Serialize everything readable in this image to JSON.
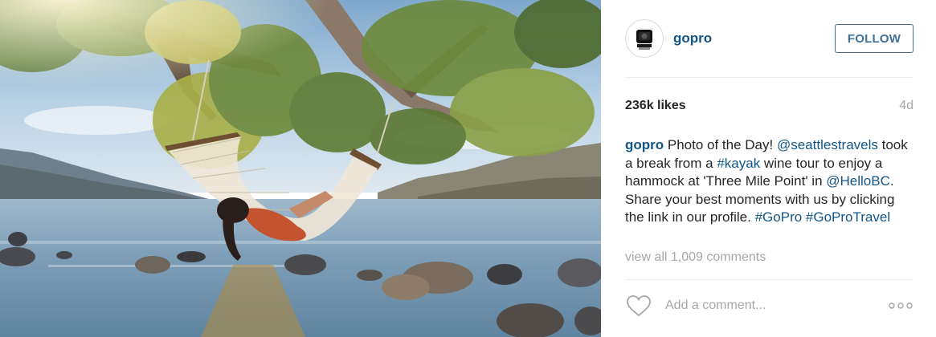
{
  "photo": {
    "alt": "Woman relaxing in a hammock hanging from a tree over a lake"
  },
  "header": {
    "username": "gopro",
    "follow_label": "FOLLOW"
  },
  "meta": {
    "likes": "236k likes",
    "timestamp": "4d"
  },
  "caption": {
    "author": "gopro",
    "segments": [
      {
        "type": "text",
        "text": " Photo of the Day! "
      },
      {
        "type": "link",
        "text": "@seattlestravels"
      },
      {
        "type": "text",
        "text": " took a break from a "
      },
      {
        "type": "link",
        "text": "#kayak"
      },
      {
        "type": "text",
        "text": " wine tour to enjoy a hammock at 'Three Mile Point' in "
      },
      {
        "type": "link",
        "text": "@HelloBC"
      },
      {
        "type": "text",
        "text": ". Share your best moments with us by clicking the link in our profile. "
      },
      {
        "type": "link",
        "text": "#GoPro"
      },
      {
        "type": "text",
        "text": " "
      },
      {
        "type": "link",
        "text": "#GoProTravel"
      }
    ]
  },
  "comments": {
    "view_all_label": "view all 1,009 comments"
  },
  "footer": {
    "comment_placeholder": "Add a comment...",
    "like_icon": "heart-outline-icon",
    "more_icon": "ellipsis-icon"
  },
  "colors": {
    "link": "#125688",
    "follow": "#3f729b",
    "muted": "#a5a7aa",
    "text": "#262626",
    "divider": "#efefef"
  }
}
